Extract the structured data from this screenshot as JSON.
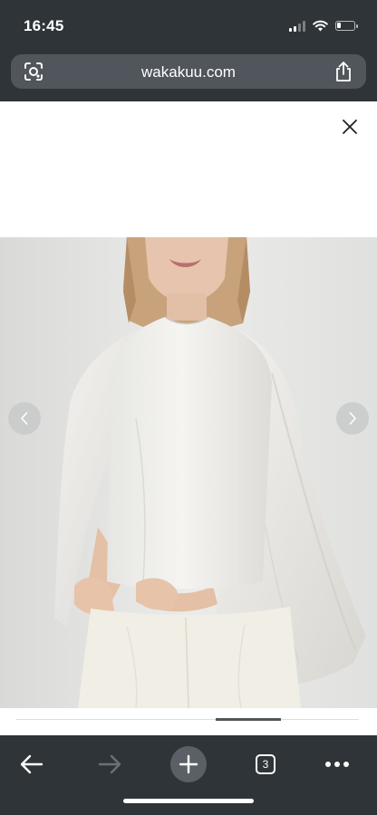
{
  "status_bar": {
    "time": "16:45",
    "signal_bars_lit": 2,
    "signal_bars_total": 4,
    "battery_level": 0.25
  },
  "url_bar": {
    "url": "wakakuu.com"
  },
  "icons": {
    "lens": "visual-search-icon",
    "share": "share-icon",
    "close": "close-icon",
    "prev": "chevron-left-icon",
    "next": "chevron-right-icon",
    "back": "arrow-left-icon",
    "forward": "arrow-right-icon",
    "new_tab": "plus-icon",
    "more": "more-dots-icon"
  },
  "gallery": {
    "scroll_position": 0.65
  },
  "toolbar": {
    "tab_count": "3"
  },
  "colors": {
    "chrome": "#2f3438",
    "url_pill": "#50565b",
    "blouse": "#f2f1ee"
  }
}
